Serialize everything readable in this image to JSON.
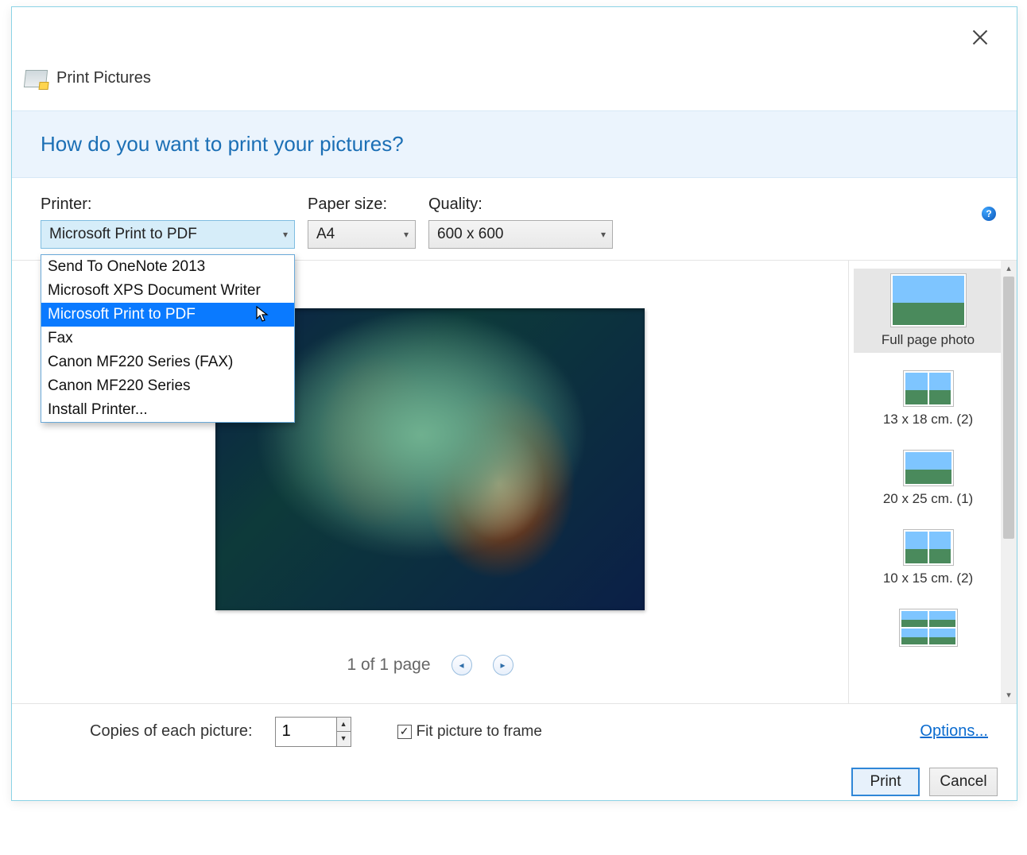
{
  "window": {
    "title": "Print Pictures"
  },
  "header": {
    "question": "How do you want to print your pictures?"
  },
  "fields": {
    "printer_label": "Printer:",
    "paper_label": "Paper size:",
    "quality_label": "Quality:",
    "printer_selected": "Microsoft Print to PDF",
    "paper_selected": "A4",
    "quality_selected": "600 x 600"
  },
  "printer_options": [
    "Send To OneNote 2013",
    "Microsoft XPS Document Writer",
    "Microsoft Print to PDF",
    "Fax",
    "Canon MF220 Series (FAX)",
    "Canon MF220 Series",
    "Install Printer..."
  ],
  "printer_hover_index": 2,
  "pager": {
    "text": "1 of 1 page"
  },
  "layouts": [
    {
      "label": "Full page photo",
      "selected": true,
      "kind": "full"
    },
    {
      "label": "13 x 18 cm. (2)",
      "selected": false,
      "kind": "two"
    },
    {
      "label": "20 x 25 cm. (1)",
      "selected": false,
      "kind": "one"
    },
    {
      "label": "10 x 15 cm. (2)",
      "selected": false,
      "kind": "two"
    },
    {
      "label": "",
      "selected": false,
      "kind": "grid"
    }
  ],
  "bottom": {
    "copies_label": "Copies of each picture:",
    "copies_value": "1",
    "fit_label": "Fit picture to frame",
    "fit_checked": true,
    "options_link": "Options..."
  },
  "buttons": {
    "print": "Print",
    "cancel": "Cancel"
  }
}
